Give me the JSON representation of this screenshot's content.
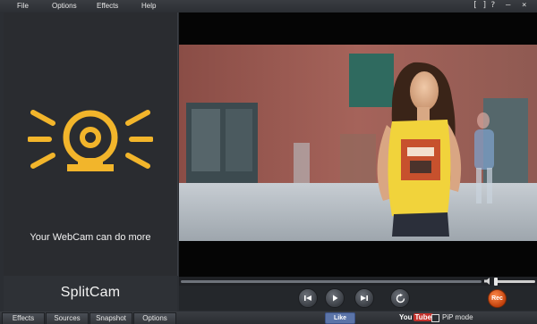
{
  "menu": {
    "items": [
      "File",
      "Options",
      "Effects",
      "Help"
    ],
    "window_controls": [
      "[ ]",
      "?",
      "–",
      "×"
    ]
  },
  "left_panel": {
    "tagline": "Your WebCam can do more",
    "logo_icon": "webcam-rays-icon"
  },
  "brand": {
    "name": "SplitCam"
  },
  "player": {
    "seek_progress": 0,
    "volume_level": 0.05
  },
  "controls": {
    "prev_icon": "skip-back-icon",
    "play_icon": "play-icon",
    "next_icon": "skip-forward-icon",
    "refresh_icon": "refresh-icon",
    "rec_label": "Rec"
  },
  "bottom": {
    "tabs": [
      "Effects",
      "Sources",
      "Snapshot",
      "Options"
    ],
    "like_label": "Like",
    "youtube_label": "You",
    "youtube_tube": "Tube",
    "pip_label": "PiP mode",
    "pip_checked": false
  },
  "colors": {
    "accent": "#f2b52b",
    "background": "#2b2e33",
    "rec": "#e0561c"
  }
}
